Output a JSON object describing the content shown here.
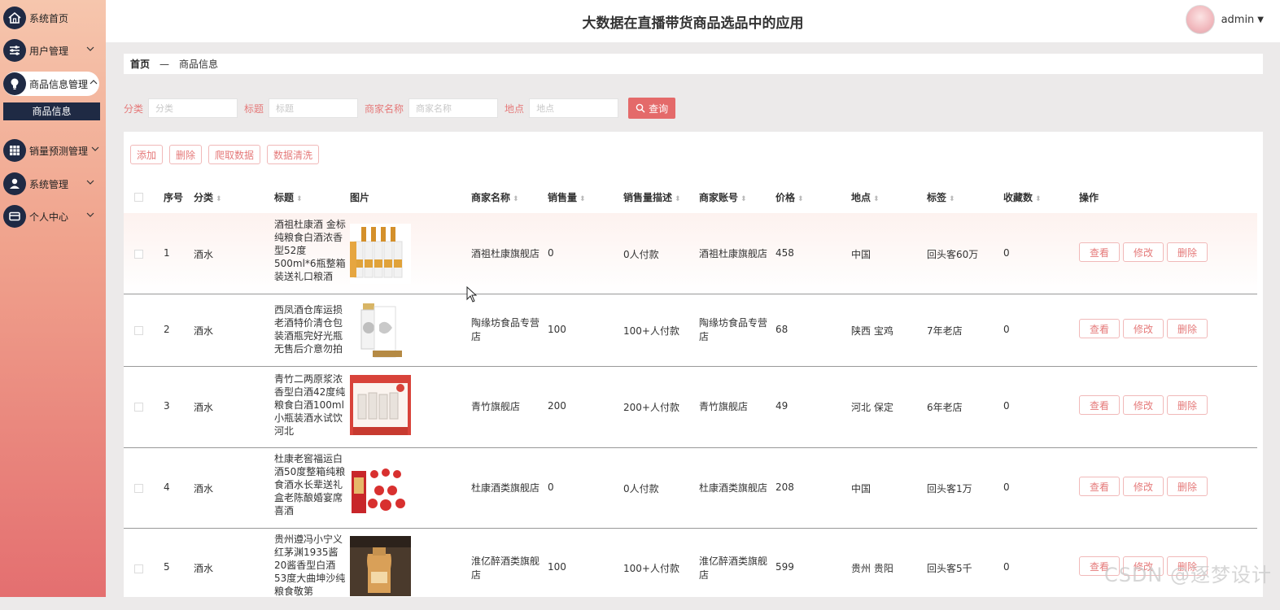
{
  "app": {
    "title": "大数据在直播带货商品选品中的应用"
  },
  "user": {
    "name": "admin"
  },
  "sidebar": {
    "items": [
      {
        "label": "系统首页",
        "icon": "home-icon"
      },
      {
        "label": "用户管理",
        "icon": "sliders-icon"
      },
      {
        "label": "商品信息管理",
        "icon": "bulb-icon"
      },
      {
        "label": "销量预测管理",
        "icon": "grid-icon"
      },
      {
        "label": "系统管理",
        "icon": "person-icon"
      },
      {
        "label": "个人中心",
        "icon": "wallet-icon"
      }
    ],
    "sub_item": "商品信息"
  },
  "breadcrumb": {
    "home": "首页",
    "sep": "—",
    "current": "商品信息"
  },
  "search": {
    "fields": [
      {
        "label": "分类",
        "placeholder": "分类"
      },
      {
        "label": "标题",
        "placeholder": "标题"
      },
      {
        "label": "商家名称",
        "placeholder": "商家名称"
      },
      {
        "label": "地点",
        "placeholder": "地点"
      }
    ],
    "button": "查询"
  },
  "actions": {
    "add": "添加",
    "delete": "删除",
    "crawl": "爬取数据",
    "clean": "数据清洗"
  },
  "table": {
    "headers": {
      "index": "序号",
      "category": "分类",
      "title": "标题",
      "image": "图片",
      "shop": "商家名称",
      "sales": "销售量",
      "sales_desc": "销售量描述",
      "account": "商家账号",
      "price": "价格",
      "location": "地点",
      "tag": "标签",
      "favorites": "收藏数",
      "ops": "操作"
    },
    "ops": {
      "view": "查看",
      "edit": "修改",
      "delete": "删除"
    },
    "rows": [
      {
        "index": "1",
        "category": "酒水",
        "title": "酒祖杜康酒 金标纯粮食白酒浓香型52度500ml*6瓶整箱装送礼口粮酒",
        "shop": "酒祖杜康旗舰店",
        "sales": "0",
        "sales_desc": "0人付款",
        "account": "酒祖杜康旗舰店",
        "price": "458",
        "location": "中国",
        "tag": "回头客60万",
        "favorites": "0"
      },
      {
        "index": "2",
        "category": "酒水",
        "title": "西凤酒仓库运损老酒特价清仓包装酒瓶完好光瓶无售后介意勿拍",
        "shop": "陶缘坊食品专营店",
        "sales": "100",
        "sales_desc": "100+人付款",
        "account": "陶缘坊食品专营店",
        "price": "68",
        "location": "陕西 宝鸡",
        "tag": "7年老店",
        "favorites": "0"
      },
      {
        "index": "3",
        "category": "酒水",
        "title": "青竹二两原浆浓香型白酒42度纯粮食白酒100ml小瓶装酒水试饮河北",
        "shop": "青竹旗舰店",
        "sales": "200",
        "sales_desc": "200+人付款",
        "account": "青竹旗舰店",
        "price": "49",
        "location": "河北 保定",
        "tag": "6年老店",
        "favorites": "0"
      },
      {
        "index": "4",
        "category": "酒水",
        "title": "杜康老窖福运白酒50度整箱纯粮食酒水长辈送礼盒老陈酿婚宴席喜酒",
        "shop": "杜康酒类旗舰店",
        "sales": "0",
        "sales_desc": "0人付款",
        "account": "杜康酒类旗舰店",
        "price": "208",
        "location": "中国",
        "tag": "回头客1万",
        "favorites": "0"
      },
      {
        "index": "5",
        "category": "酒水",
        "title": "贵州遵冯小宁义红茅渊1935酱20酱香型白酒53度大曲坤沙纯粮食敬第",
        "shop": "淮亿醉酒类旗舰店",
        "sales": "100",
        "sales_desc": "100+人付款",
        "account": "淮亿醉酒类旗舰店",
        "price": "599",
        "location": "贵州 贵阳",
        "tag": "回头客5千",
        "favorites": "0"
      }
    ]
  },
  "watermark": "CSDN @逐梦设计",
  "colors": {
    "accent": "#e46a6a",
    "nav_dark": "#1f2a44",
    "label_pink": "#e57a7a"
  }
}
